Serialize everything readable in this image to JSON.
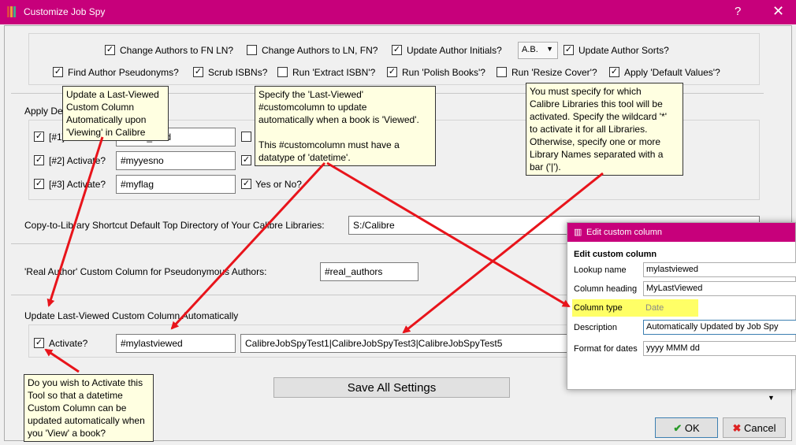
{
  "window": {
    "title": "Customize Job Spy",
    "help": "?",
    "close": "✕",
    "accent": "#c7007b"
  },
  "top_options": {
    "change_fn_ln": "Change Authors to FN LN?",
    "change_ln_fn": "Change Authors to LN, FN?",
    "update_initials": "Update Author Initials?",
    "initials_value": "A.B.",
    "update_sorts": "Update Author Sorts?",
    "find_pseudonyms": "Find Author Pseudonyms?",
    "scrub_isbns": "Scrub ISBNs?",
    "run_extract_isbn": "Run 'Extract ISBN'?",
    "run_polish": "Run 'Polish Books'?",
    "run_resize": "Run 'Resize Cover'?",
    "apply_defaults": "Apply 'Default Values'?"
  },
  "defaults_section": {
    "label": "Apply De",
    "rows": [
      {
        "label": "[#1] Activate?",
        "value": "#been_read"
      },
      {
        "label": "[#2] Activate?",
        "value": "#myyesno"
      },
      {
        "label": "[#3] Activate?",
        "value": "#myflag",
        "extra": "Yes or No?"
      }
    ]
  },
  "copy_to_library": {
    "label": "Copy-to-Library Shortcut Default Top Directory of Your Calibre Libraries:",
    "value": "S:/Calibre"
  },
  "real_author": {
    "label": "'Real Author' Custom Column for Pseudonymous Authors:",
    "value": "#real_authors"
  },
  "last_viewed": {
    "section_label": "Update Last-Viewed Custom Column Automatically",
    "activate_label": "Activate?",
    "column_value": "#mylastviewed",
    "libraries_value": "CalibreJobSpyTest1|CalibreJobSpyTest3|CalibreJobSpyTest5"
  },
  "buttons": {
    "save_all": "Save All Settings",
    "ok": "OK",
    "cancel": "Cancel"
  },
  "tooltips": {
    "last_viewed": "Update a Last-Viewed\nCustom Column\nAutomatically upon\n'Viewing' in Calibre",
    "specify_column": "Specify the 'Last-Viewed'\n#customcolumn to update\nautomatically when a book is 'Viewed'.\n\nThis #customcolumn must have a\ndatatype of 'datetime'.",
    "libraries": "You must specify for which\nCalibre Libraries this tool will be\nactivated. Specify the wildcard '*'\nto activate it for all Libraries.\nOtherwise, specify one or more\nLibrary Names separated with a\nbar ('|').",
    "activate": "Do you wish to Activate this\nTool so that a datetime\nCustom Column can be\nupdated automatically when\nyou 'View' a book?"
  },
  "edit_custom_column": {
    "window_title": "Edit custom column",
    "heading": "Edit custom column",
    "lookup_label": "Lookup name",
    "lookup_value": "mylastviewed",
    "heading_label": "Column heading",
    "heading_value": "MyLastViewed",
    "type_label": "Column type",
    "type_value": "Date",
    "description_label": "Description",
    "description_value": "Automatically Updated by Job Spy",
    "format_label": "Format for dates",
    "format_value": "yyyy MMM dd",
    "highlight": "#ffff66"
  },
  "annotation_color": "#e8141b"
}
